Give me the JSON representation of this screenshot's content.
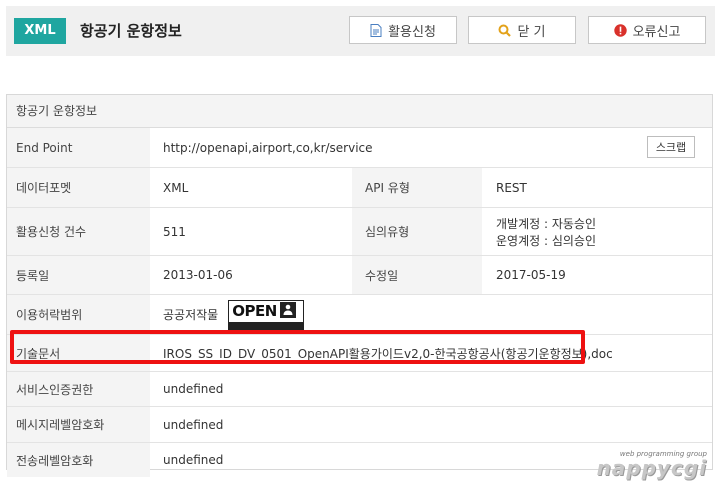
{
  "header": {
    "badge": "XML",
    "title": "항공기 운항정보",
    "buttons": [
      {
        "label": "활용신청",
        "icon": "document-icon"
      },
      {
        "label": "닫 기",
        "icon": "search-icon"
      },
      {
        "label": "오류신고",
        "icon": "alert-icon"
      }
    ]
  },
  "panel": {
    "title": "항공기 운항정보",
    "end_point": {
      "label": "End Point",
      "value": "http://openapi,airport,co,kr/service",
      "scrap_label": "스크랩"
    },
    "data_format": {
      "label": "데이터포멧",
      "value": "XML",
      "api_label": "API 유형",
      "api_value": "REST"
    },
    "apply_count": {
      "label": "활용신청 건수",
      "value": "511",
      "review_label": "심의유형",
      "review_lines": [
        "개발계정 : 자동승인",
        "운영계정 : 심의승인"
      ]
    },
    "registered": {
      "label": "등록일",
      "value": "2013-01-06",
      "modified_label": "수정일",
      "modified_value": "2017-05-19"
    },
    "license": {
      "label": "이용허락범위",
      "value": "공공저작물",
      "logo_text": "OPEN"
    },
    "tech_doc": {
      "label": "기술문서",
      "value": "IROS_SS_ID_DV_0501_OpenAPI활용가이드v2,0-한국공항공사(항공기운항정보),doc"
    },
    "service_auth": {
      "label": "서비스인증권한",
      "value": "undefined"
    },
    "message_encryption": {
      "label": "메시지레벨암호화",
      "value": "undefined"
    },
    "transport_encryption": {
      "label": "전송레벨암호화",
      "value": "undefined"
    }
  },
  "watermark": {
    "small": "web programming group",
    "big": "nappycgi"
  },
  "colors": {
    "accent": "#1fa6a0",
    "highlight": "#ee1111",
    "alert": "#d9312b",
    "search": "#e3a21a",
    "doc": "#4a7fc1"
  }
}
